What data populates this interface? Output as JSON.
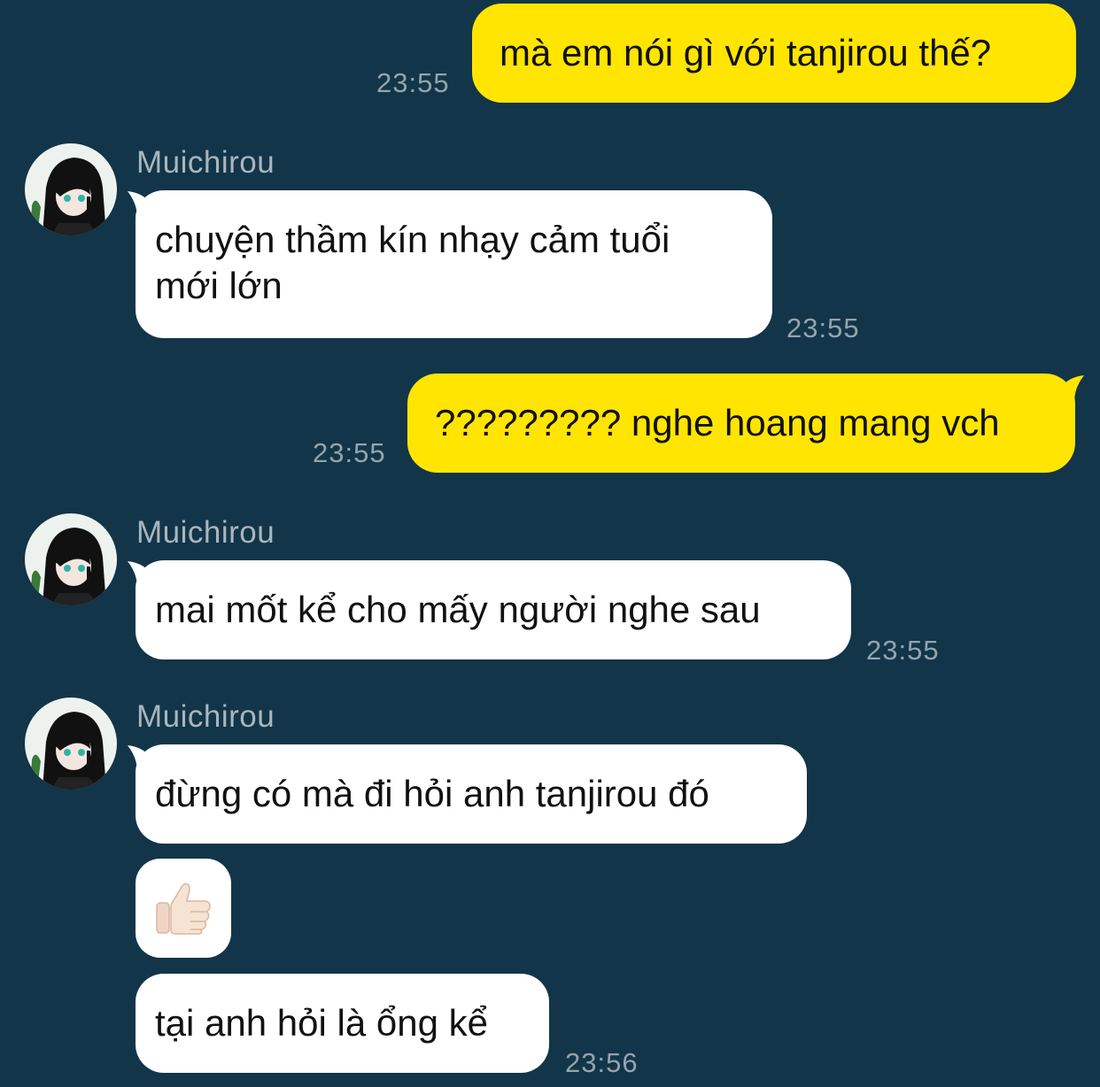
{
  "theme": {
    "background": "#123549",
    "outgoing_bubble": "#ffe500",
    "incoming_bubble": "#ffffff",
    "timestamp_color": "#93a4ad",
    "sender_color": "#a9b6bd"
  },
  "messages": [
    {
      "direction": "out",
      "text": "mà em nói gì với tanjirou thế?",
      "time": "23:55"
    },
    {
      "direction": "in",
      "sender": "Muichirou",
      "lines": [
        "chuyện thầm kín nhạy cảm tuổi",
        "mới lớn"
      ],
      "time": "23:55"
    },
    {
      "direction": "out",
      "text": "????????? nghe hoang mang vch",
      "time": "23:55"
    },
    {
      "direction": "in",
      "sender": "Muichirou",
      "text": "mai mốt kể cho mấy người nghe sau",
      "time": "23:55"
    },
    {
      "direction": "in",
      "sender": "Muichirou",
      "text": "đừng có mà đi hỏi anh tanjirou đó"
    },
    {
      "direction": "in",
      "sticker": "thumbs-up-icon"
    },
    {
      "direction": "in",
      "text": "tại anh hỏi là ổng kể",
      "time": "23:56"
    }
  ]
}
